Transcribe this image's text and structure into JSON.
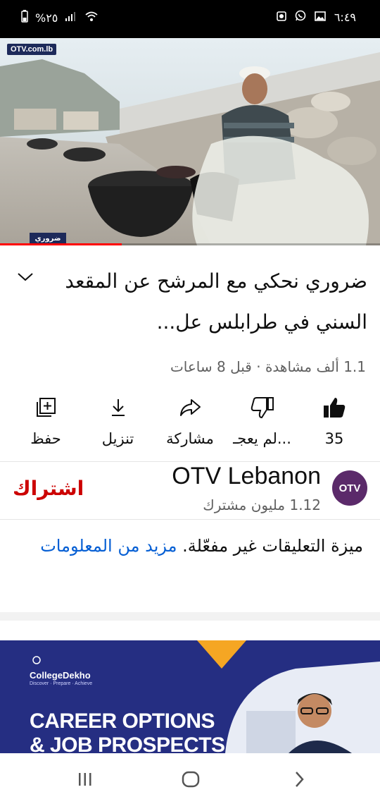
{
  "status_bar": {
    "time": "٦:٤٩",
    "battery": "%٢٥",
    "icons": [
      "screenshot-icon",
      "whatsapp-icon",
      "gallery-icon",
      "signal-icon",
      "wifi-icon",
      "battery-icon"
    ]
  },
  "video": {
    "watermark": "OTV.com.lb",
    "program_logo": "ضروري نحكي",
    "progress_fraction": 0.32
  },
  "title": "ضروري نحكي مع المرشح عن المقعد السني في طرابلس عل...",
  "meta": "1.1 ألف مشاهدة · قبل 8 ساعات",
  "actions": [
    {
      "id": "like",
      "label": "35",
      "icon": "thumbs-up-icon"
    },
    {
      "id": "dislike",
      "label": "لم يعجـ...",
      "icon": "thumbs-down-icon"
    },
    {
      "id": "share",
      "label": "مشاركة",
      "icon": "share-icon"
    },
    {
      "id": "download",
      "label": "تنزيل",
      "icon": "download-icon"
    },
    {
      "id": "save",
      "label": "حفظ",
      "icon": "save-to-playlist-icon"
    }
  ],
  "channel": {
    "avatar_text": "OTV",
    "name": "OTV Lebanon",
    "subscribers": "1.12 مليون مشترك",
    "subscribe_label": "اشتراك"
  },
  "comments": {
    "disabled_text": "ميزة التعليقات غير مفعّلة. ",
    "more_info": "مزيد من المعلومات"
  },
  "ad": {
    "brand": "CollegeDekho",
    "tagline": "Discover · Prepare · Achieve",
    "headline_line1": "CAREER OPTIONS",
    "headline_line2": "& JOB PROSPECTS"
  },
  "colors": {
    "accent_red": "#ff0000",
    "subscribe_red": "#cc0000",
    "link_blue": "#065fd4",
    "ad_bg": "#252e82"
  }
}
